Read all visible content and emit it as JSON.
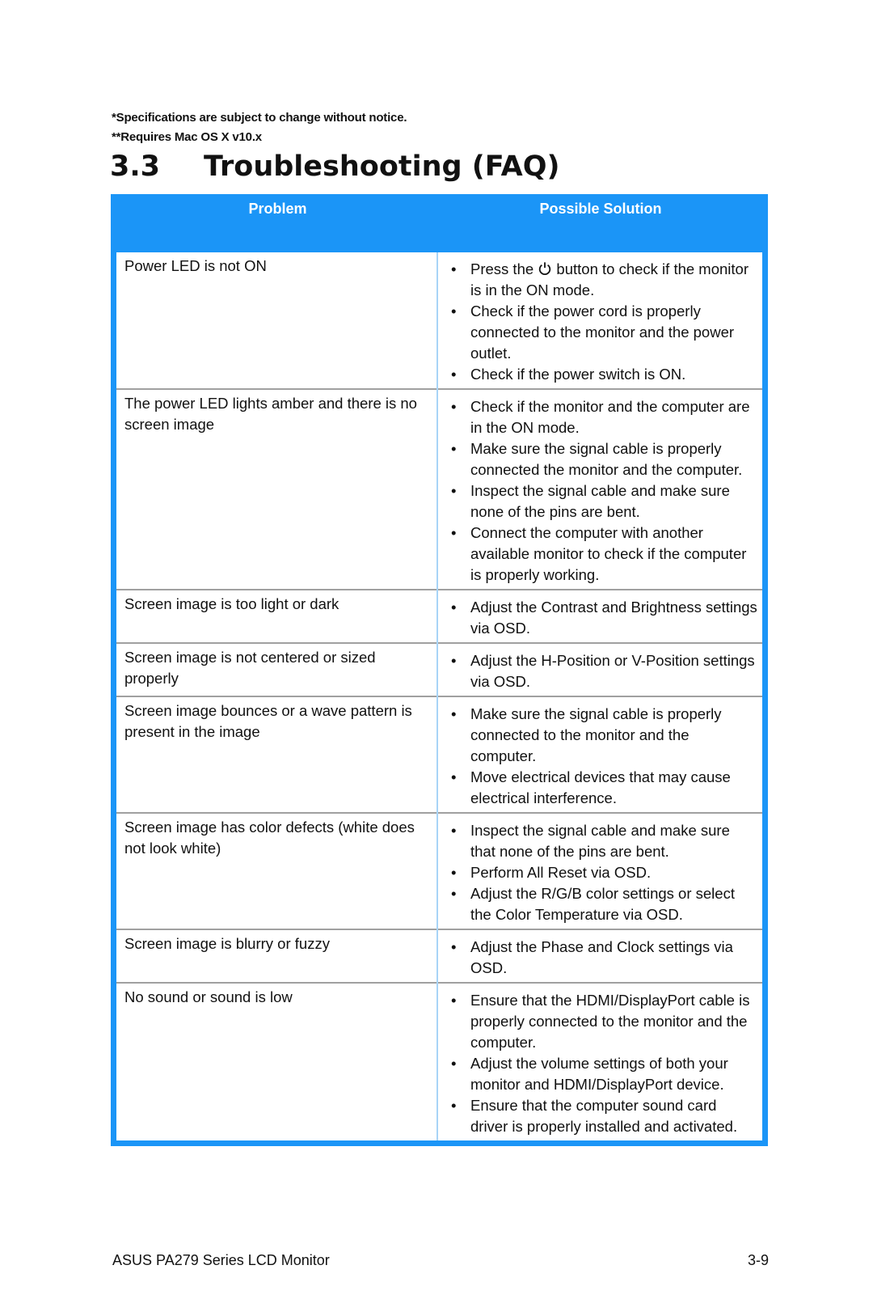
{
  "notes": [
    "*Specifications are subject to change without notice.",
    "**Requires Mac OS X v10.x"
  ],
  "section": {
    "number": "3.3",
    "title": "Troubleshooting (FAQ)"
  },
  "table": {
    "header": {
      "problem": "Problem",
      "solution": "Possible Solution"
    },
    "colors": {
      "header_bg": "#1b95f7",
      "header_text": "#ffffff"
    },
    "rows": [
      {
        "problem": "Power  LED is not ON",
        "solutions": [
          {
            "before_icon": "Press the ",
            "icon": "power-icon",
            "after_icon": " button to check if the monitor is in the ON mode."
          },
          {
            "text": "Check if the power cord is properly connected to the monitor and the power outlet."
          },
          {
            "text": "Check if the power switch is ON."
          }
        ]
      },
      {
        "problem": "The power LED lights amber and there is no screen image",
        "solutions": [
          {
            "text": "Check if the monitor and the computer are in the ON mode."
          },
          {
            "text": "Make sure the signal cable is properly connected the monitor and the computer."
          },
          {
            "text": "Inspect the signal cable and make sure none of the pins are bent."
          },
          {
            "text": "Connect the computer with another available monitor to check if the computer is properly working."
          }
        ]
      },
      {
        "problem": "Screen image is too light or dark",
        "solutions": [
          {
            "text": "Adjust the Contrast and Brightness settings via OSD."
          }
        ]
      },
      {
        "problem": "Screen image is not centered or sized properly",
        "solutions": [
          {
            "text": "Adjust the H-Position or V-Position settings via OSD."
          }
        ]
      },
      {
        "problem": "Screen image bounces or a wave pattern is present in the image",
        "solutions": [
          {
            "text": "Make sure the signal cable is properly connected to the monitor and the computer."
          },
          {
            "text": "Move electrical devices that may cause electrical interference."
          }
        ]
      },
      {
        "problem": "Screen image has color defects (white does not look white)",
        "solutions": [
          {
            "text": "Inspect the signal cable and make sure that none of the pins are bent."
          },
          {
            "text": "Perform All Reset via OSD."
          },
          {
            "text": "Adjust the R/G/B color settings or select the Color Temperature via OSD."
          }
        ]
      },
      {
        "problem": "Screen image is blurry or fuzzy",
        "solutions": [
          {
            "text": "Adjust the Phase and Clock settings via OSD."
          }
        ]
      },
      {
        "problem": "No sound or sound is low",
        "solutions": [
          {
            "text": "Ensure that the HDMI/DisplayPort cable is properly connected to the monitor and the computer."
          },
          {
            "text": "Adjust the volume settings of both your monitor and HDMI/DisplayPort device."
          },
          {
            "text": "Ensure that the computer sound card driver is properly installed and activated."
          }
        ]
      }
    ]
  },
  "footer": {
    "left": "ASUS PA279 Series LCD Monitor",
    "right": "3-9"
  }
}
